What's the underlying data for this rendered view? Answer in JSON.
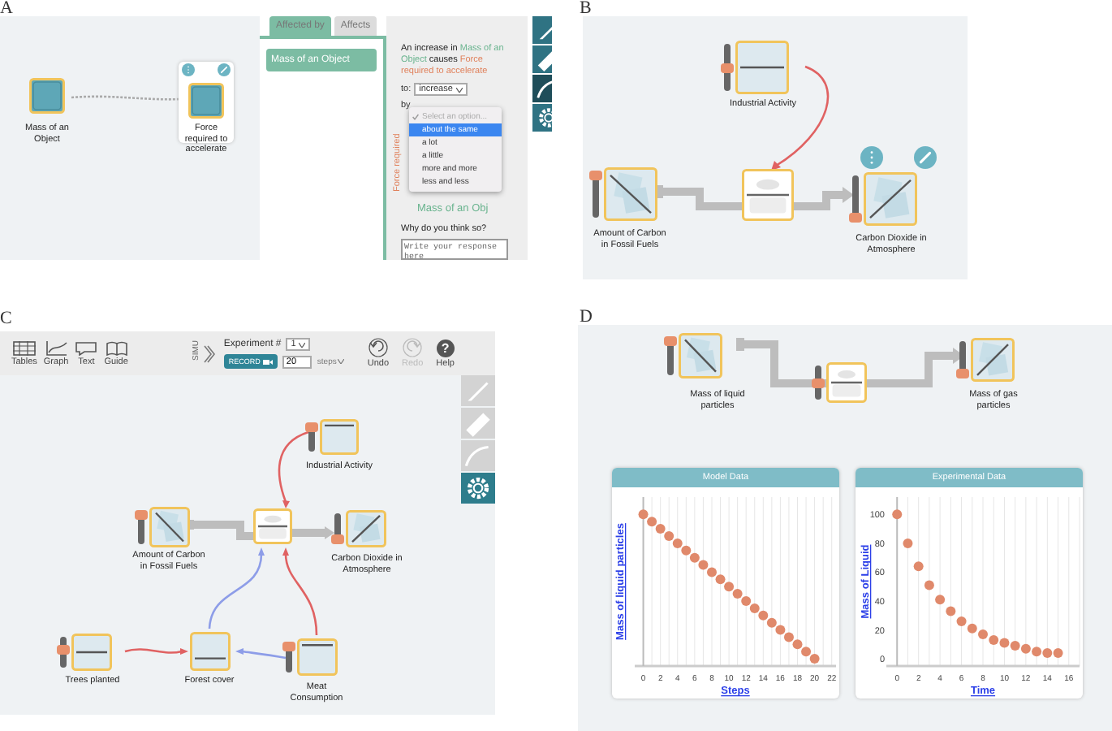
{
  "panel_a": {
    "letter": "A",
    "nodes": [
      {
        "label": "Mass of an Object",
        "kind": "variable",
        "selected": false
      },
      {
        "label": "Force required to accelerate",
        "kind": "variable",
        "selected": true
      }
    ],
    "links": [
      {
        "color": "#aaaaaa",
        "dashed": true
      }
    ],
    "tabs": [
      {
        "label": "Affected by",
        "selected": true
      },
      {
        "label": "Affects",
        "selected": false
      }
    ],
    "list_items": [
      "Mass of an Object"
    ],
    "sentence": [
      {
        "text": "An increase in ",
        "kind": "plain"
      },
      {
        "text": "Mass of an Object",
        "kind": "cause"
      },
      {
        "text": " causes ",
        "kind": "plain"
      },
      {
        "text": "Force required to accelerate",
        "kind": "effect"
      }
    ],
    "to_label": "to:",
    "to_value": "increase",
    "by_label": "by",
    "options": [
      {
        "label": "Select an option...",
        "kind": "placeholder",
        "checked": true,
        "selected": false
      },
      {
        "label": "about the same",
        "kind": "option",
        "checked": false,
        "selected": true
      },
      {
        "label": "a lot",
        "kind": "option",
        "checked": false,
        "selected": false
      },
      {
        "label": "a little",
        "kind": "option",
        "checked": false,
        "selected": false
      },
      {
        "label": "more and more",
        "kind": "option",
        "checked": false,
        "selected": false
      },
      {
        "label": "less and less",
        "kind": "option",
        "checked": false,
        "selected": false
      }
    ],
    "side_title": "Force required",
    "side_node": "Mass of an Obj",
    "question": "Why do you think so?",
    "answer": {
      "placeholder": "Write your response here"
    },
    "tools": [
      {
        "kind": "brush",
        "selected": false
      },
      {
        "kind": "ruler",
        "selected": false
      },
      {
        "kind": "curve",
        "selected": true
      },
      {
        "kind": "gear",
        "selected": false
      }
    ]
  },
  "panel_b": {
    "letter": "B",
    "nodes": [
      {
        "label": "Industrial Activity",
        "kind": "converter",
        "graph": {
          "kind": "middle"
        },
        "level": 0.5,
        "selected": false
      },
      {
        "label": "Amount of Carbon in Fossil Fuels",
        "kind": "stock",
        "graph": {
          "kind": "falling"
        },
        "level": 1,
        "selected": false
      },
      {
        "kind": "valve",
        "selected": false
      },
      {
        "label": "Carbon Dioxide in Atmosphere",
        "kind": "stock",
        "graph": {
          "kind": "rising"
        },
        "level": 0,
        "selected": true
      }
    ],
    "links": [
      {
        "color": "#e06262",
        "dashed": false
      }
    ]
  },
  "panel_c": {
    "letter": "C",
    "toolbar": {
      "tools": [
        {
          "kind": "tables",
          "label": "Tables"
        },
        {
          "kind": "graph",
          "label": "Graph"
        },
        {
          "kind": "text",
          "label": "Text"
        },
        {
          "kind": "guide",
          "label": "Guide"
        }
      ],
      "simulate": "SIMU",
      "experiment_label": "Experiment #",
      "experiment_value": "1",
      "record": "RECORD",
      "steps_value": "20",
      "steps_unit": "steps",
      "undo": {
        "label": "Undo",
        "disabled": false
      },
      "redo": {
        "label": "Redo",
        "disabled": true
      },
      "help": {
        "glyph": "?",
        "label": "Help"
      }
    },
    "palette": [
      {
        "kind": "brush",
        "selected": false
      },
      {
        "kind": "ruler",
        "selected": false
      },
      {
        "kind": "curve",
        "selected": false
      },
      {
        "kind": "gear",
        "selected": true
      }
    ],
    "nodes": [
      {
        "label": "Industrial Activity",
        "kind": "converter",
        "graph": {
          "kind": "high"
        },
        "level": 1,
        "selected": false
      },
      {
        "label": "Amount of Carbon in Fossil Fuels",
        "kind": "stock",
        "graph": {
          "kind": "falling"
        },
        "level": 1,
        "selected": false
      },
      {
        "kind": "valve",
        "selected": false
      },
      {
        "label": "Carbon Dioxide in Atmosphere",
        "kind": "stock",
        "graph": {
          "kind": "rising"
        },
        "level": 0,
        "selected": false
      },
      {
        "label": "Trees planted",
        "kind": "converter",
        "graph": {
          "kind": "middle"
        },
        "level": 0.6,
        "selected": false
      },
      {
        "label": "Forest cover",
        "kind": "converter",
        "graph": {
          "kind": "low"
        },
        "selected": false
      },
      {
        "label": "Meat Consumption",
        "kind": "converter",
        "graph": {
          "kind": "high"
        },
        "level": 1,
        "selected": false
      }
    ],
    "links": [
      {
        "color": "#e06262",
        "dashed": false
      },
      {
        "color": "#8d9de8",
        "dashed": false
      },
      {
        "color": "#e06262",
        "dashed": false
      },
      {
        "color": "#e06262",
        "dashed": false
      },
      {
        "color": "#8d9de8",
        "dashed": false
      }
    ]
  },
  "panel_d": {
    "letter": "D",
    "nodes": [
      {
        "label": "Mass of liquid particles",
        "kind": "stock",
        "graph": {
          "kind": "falling"
        },
        "level": 1,
        "selected": false
      },
      {
        "kind": "valve",
        "level": 0.5,
        "selected": false
      },
      {
        "label": "Mass of gas particles",
        "kind": "stock",
        "graph": {
          "kind": "rising"
        },
        "level": 0,
        "selected": false
      }
    ],
    "model_chart": {
      "title": "Model Data",
      "xlabel": "Steps",
      "ylabel": "Mass of liquid particles",
      "xtick_labels": [
        "0",
        "2",
        "4",
        "6",
        "8",
        "10",
        "12",
        "14",
        "16",
        "18",
        "20",
        "22"
      ]
    },
    "experiment_chart": {
      "chart_data": {
        "type": "scatter",
        "title": "Experimental Data",
        "xlabel": "Time",
        "ylabel": "Mass of Liquid",
        "x": [
          0,
          1,
          2,
          3,
          4,
          5,
          6,
          7,
          8,
          9,
          10,
          11,
          12,
          13,
          14,
          15
        ],
        "series": [
          {
            "color": "#e0896b",
            "values": [
              100,
              80,
              64,
              51,
              41,
              33,
              26,
              21,
              17,
              13,
              11,
              9,
              7,
              5,
              4,
              4
            ]
          }
        ],
        "xlim": [
          -1,
          17
        ],
        "ylim": [
          -5,
          112
        ],
        "grid": true,
        "xticks": [
          0,
          2,
          4,
          6,
          8,
          10,
          12,
          14,
          16
        ],
        "yticks": [
          0,
          20,
          40,
          60,
          80,
          100
        ]
      }
    }
  }
}
